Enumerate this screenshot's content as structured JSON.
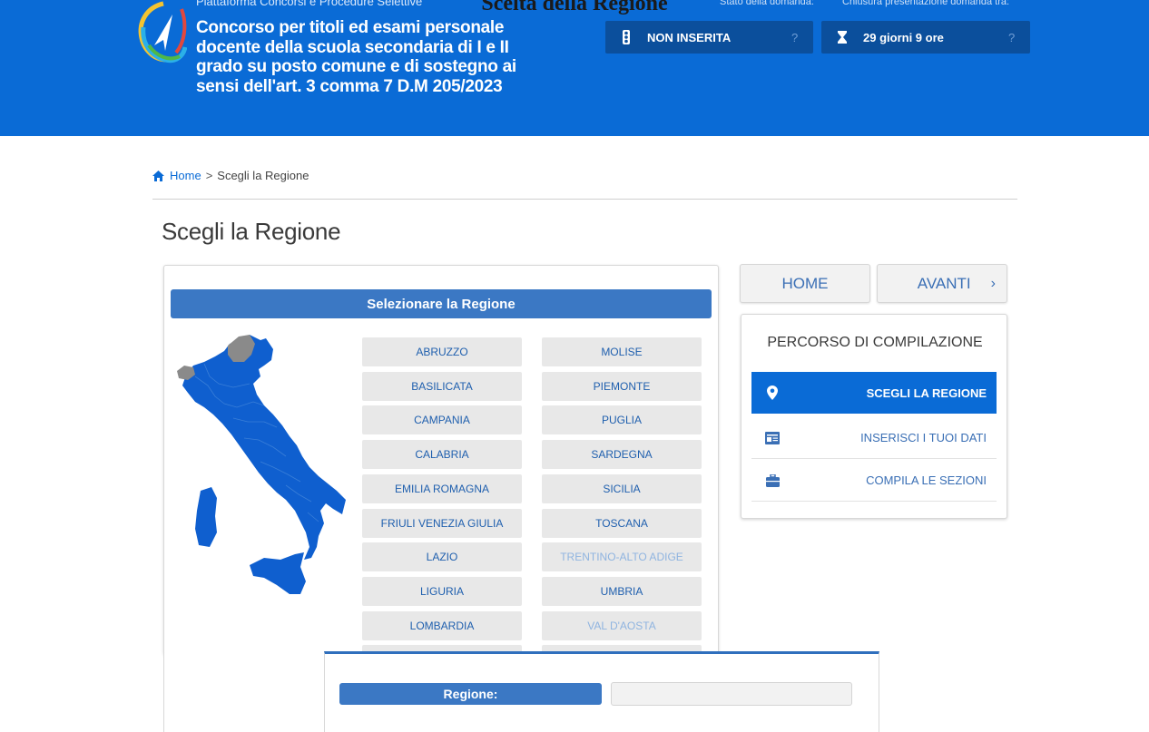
{
  "overlay_title": "Scelta della Regione",
  "header": {
    "platform": "Piattaforma Concorsi e Procedure Selettive",
    "title": "Concorso per titoli ed esami personale docente della scuola secondaria di I e II grado su posto comune e di sostegno ai sensi dell'art. 3 comma 7 D.M 205/2023",
    "status_caption": "Stato della domanda:",
    "status_value": "NON INSERITA",
    "deadline_caption": "Chiusura presentazione domanda tra:",
    "deadline_value": "29 giorni 9 ore",
    "help_glyph": "?"
  },
  "breadcrumb": {
    "home": "Home",
    "separator": ">",
    "current": "Scegli la Regione"
  },
  "page_title": "Scegli la Regione",
  "panel_heading": "Selezionare la Regione",
  "regions": {
    "left": [
      "ABRUZZO",
      "BASILICATA",
      "CAMPANIA",
      "CALABRIA",
      "EMILIA ROMAGNA",
      "FRIULI VENEZIA GIULIA",
      "LAZIO",
      "LIGURIA",
      "LOMBARDIA"
    ],
    "right": [
      "MOLISE",
      "PIEMONTE",
      "PUGLIA",
      "SARDEGNA",
      "SICILIA",
      "TOSCANA",
      "TRENTINO-ALTO ADIGE",
      "UMBRIA",
      "VAL D'AOSTA"
    ],
    "disabled": [
      "TRENTINO-ALTO ADIGE",
      "VAL D'AOSTA"
    ]
  },
  "form": {
    "label": "Regione:",
    "value": ""
  },
  "nav": {
    "home": "HOME",
    "next": "AVANTI",
    "next_arrow": "›"
  },
  "steps": {
    "title": "PERCORSO DI COMPILAZIONE",
    "items": [
      {
        "label": "SCEGLI LA REGIONE",
        "icon": "map-pin-icon",
        "active": true
      },
      {
        "label": "INSERISCI I TUOI DATI",
        "icon": "id-card-icon",
        "active": false
      },
      {
        "label": "COMPILA LE SEZIONI",
        "icon": "briefcase-icon",
        "active": false
      }
    ]
  },
  "colors": {
    "brand_blue": "#0a6bd6",
    "status_box": "#0b4f9c",
    "panel_head": "#3b78c4",
    "map_blue": "#0f5fcf",
    "map_gray": "#8a8a8a"
  }
}
